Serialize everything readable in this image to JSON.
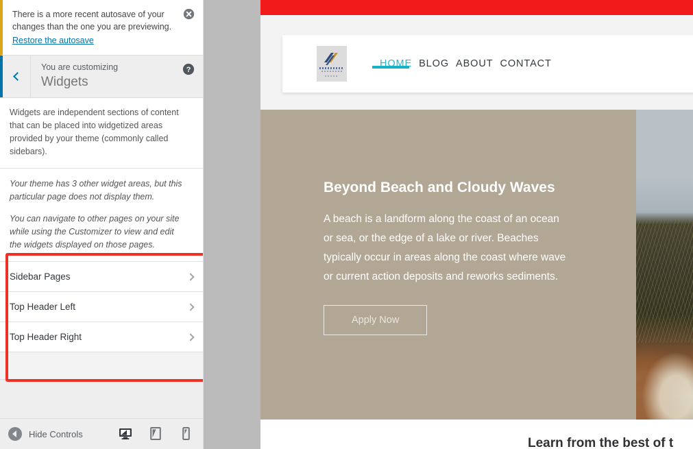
{
  "customizer": {
    "autosave_notice": {
      "text": "There is a more recent autosave of your changes than the one you are previewing.",
      "link_label": "Restore the autosave",
      "dismiss_icon": "close-circle-icon",
      "accent_color": "#dba617"
    },
    "header": {
      "back_icon": "chevron-left-icon",
      "eyebrow": "You are customizing",
      "title": "Widgets",
      "help_icon": "help-circle-icon",
      "accent_color": "#0073aa"
    },
    "description": "Widgets are independent sections of content that can be placed into widgetized areas provided by your theme (commonly called sidebars).",
    "notes": [
      "Your theme has 3 other widget areas, but this particular page does not display them.",
      "You can navigate to other pages on your site while using the Customizer to view and edit the widgets displayed on those pages."
    ],
    "widget_areas": [
      {
        "label": "Sidebar Pages",
        "arrow_icon": "chevron-right-icon"
      },
      {
        "label": "Top Header Left",
        "arrow_icon": "chevron-right-icon"
      },
      {
        "label": "Top Header Right",
        "arrow_icon": "chevron-right-icon"
      }
    ],
    "annotation": {
      "color": "#ee3124",
      "shape": "rectangle"
    },
    "footer": {
      "collapse_icon": "collapse-arrow-icon",
      "collapse_label": "Hide Controls",
      "devices": [
        {
          "name": "desktop",
          "icon": "desktop-icon",
          "active": true
        },
        {
          "name": "tablet",
          "icon": "tablet-icon",
          "active": false
        },
        {
          "name": "mobile",
          "icon": "mobile-icon",
          "active": false
        }
      ]
    }
  },
  "preview": {
    "admin_bar_color": "#f21b1b",
    "site_header": {
      "logo_icon": "site-logo-icon",
      "nav": [
        {
          "label": "HOME",
          "active": true
        },
        {
          "label": "BLOG",
          "active": false
        },
        {
          "label": "ABOUT",
          "active": false
        },
        {
          "label": "CONTACT",
          "active": false
        }
      ],
      "active_color": "#29b6c8"
    },
    "hero": {
      "background_color": "#b2a694",
      "title": "Beyond Beach and Cloudy Waves",
      "body": "A beach is a landform along the coast of an ocean or sea, or the edge of a lake or river. Beaches typically occur in areas along the coast where wave or current action deposits and reworks sediments.",
      "cta_label": "Apply Now",
      "image_alt": "beach-dunes-photo"
    },
    "below_section": {
      "title": "Learn from the best of t"
    }
  }
}
